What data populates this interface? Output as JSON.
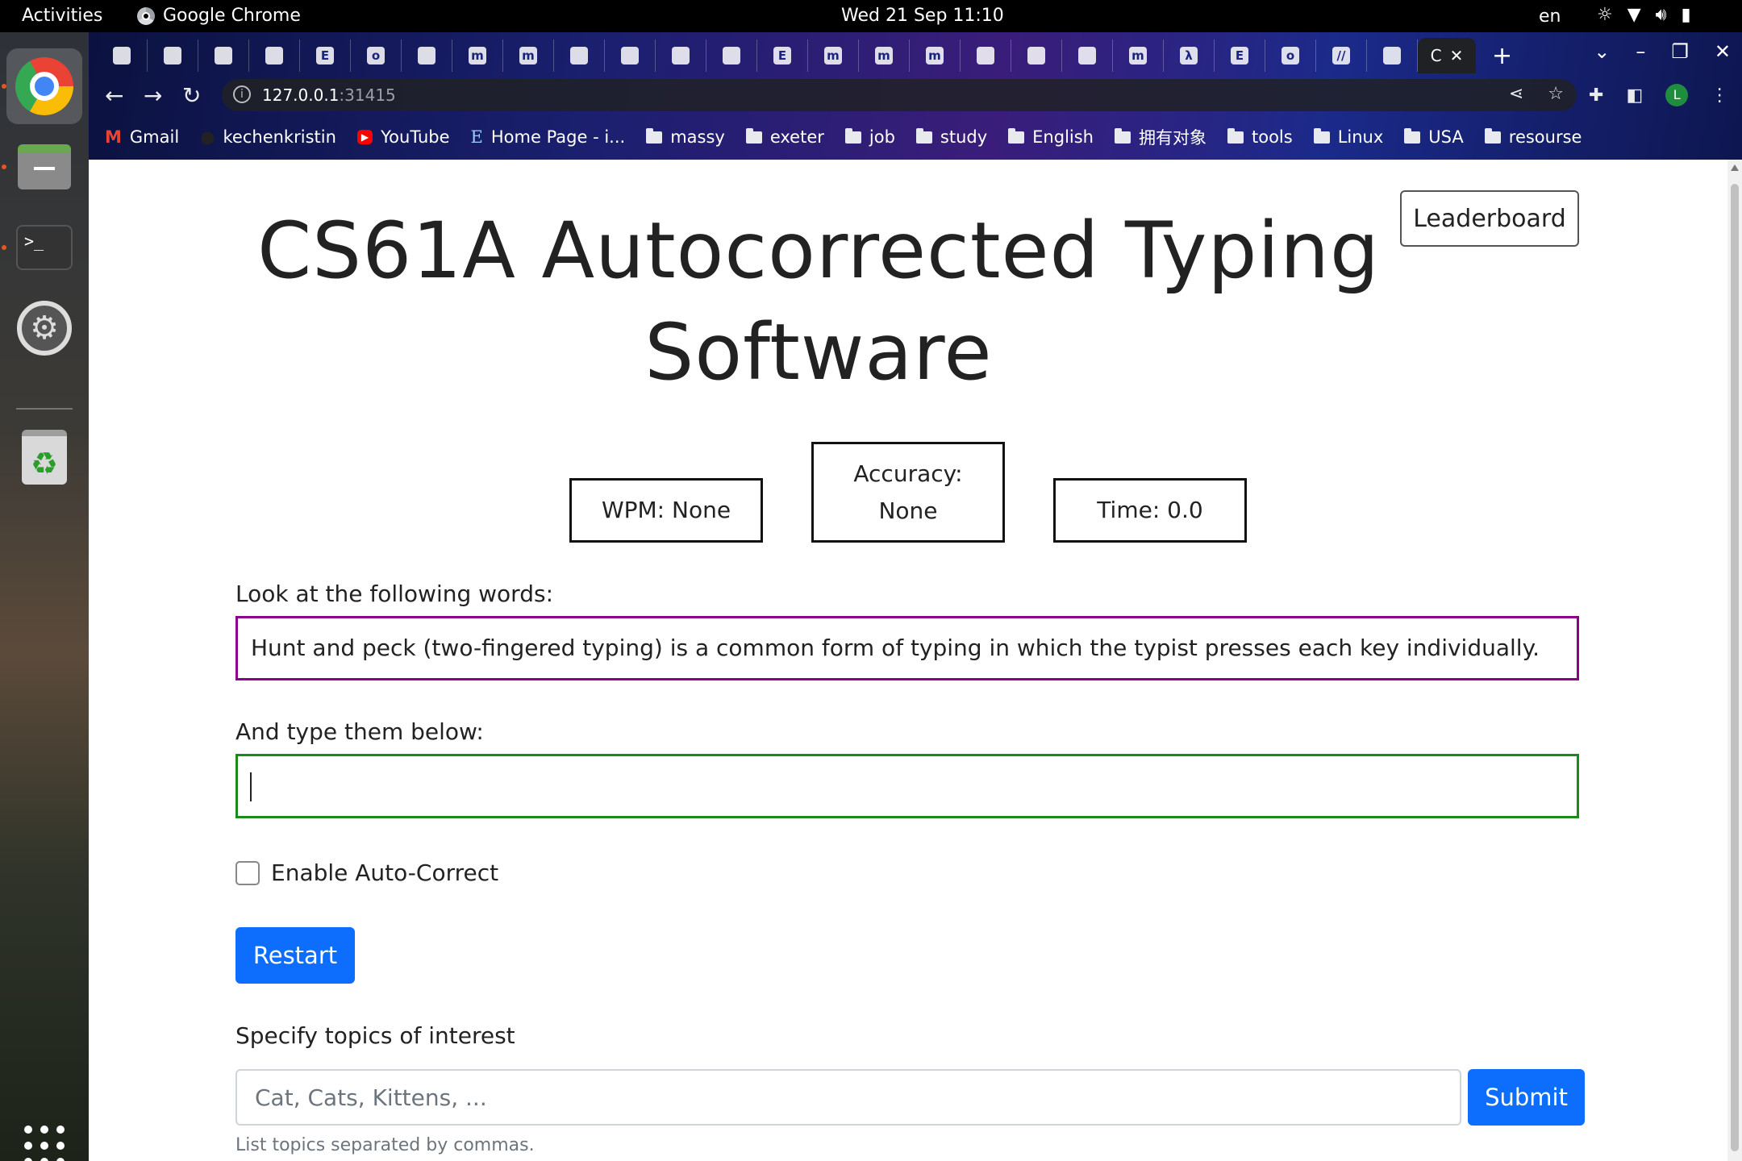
{
  "topbar": {
    "activities": "Activities",
    "app_name": "Google Chrome",
    "clock": "Wed 21 Sep  11:10",
    "language": "en"
  },
  "browser": {
    "url_host": "127.0.0.1",
    "url_port": ":31415",
    "tab_favicons": [
      "",
      "",
      "",
      "",
      "E",
      "o",
      "",
      "m",
      "m",
      "",
      "",
      "",
      "",
      "E",
      "m",
      "m",
      "m",
      "",
      "",
      "",
      "m",
      "λ",
      "E",
      "o",
      "//",
      ""
    ],
    "active_tab_label": "C",
    "profile_initial": "L",
    "bookmarks": [
      {
        "label": "Gmail",
        "icon": "gmail-icon"
      },
      {
        "label": "kechenkristin",
        "icon": "github-icon"
      },
      {
        "label": "YouTube",
        "icon": "youtube-icon"
      },
      {
        "label": "Home Page - i...",
        "icon": "e-icon"
      },
      {
        "label": "massy",
        "icon": "folder-icon"
      },
      {
        "label": "exeter",
        "icon": "folder-icon"
      },
      {
        "label": "job",
        "icon": "folder-icon"
      },
      {
        "label": "study",
        "icon": "folder-icon"
      },
      {
        "label": "English",
        "icon": "folder-icon"
      },
      {
        "label": "拥有对象",
        "icon": "folder-icon"
      },
      {
        "label": "tools",
        "icon": "folder-icon"
      },
      {
        "label": "Linux",
        "icon": "folder-icon"
      },
      {
        "label": "USA",
        "icon": "folder-icon"
      },
      {
        "label": "resourse",
        "icon": "folder-icon"
      }
    ]
  },
  "page": {
    "title": "CS61A Autocorrected Typing Software",
    "leaderboard_label": "Leaderboard",
    "stats": {
      "wpm": "WPM: None",
      "accuracy_label": "Accuracy:",
      "accuracy_value": "None",
      "time": "Time: 0.0"
    },
    "prompt_label": "Look at the following words:",
    "prompt_text": "Hunt and peck (two-fingered typing) is a common form of typing in which the typist presses each key individually.",
    "input_label": "And type them below:",
    "input_value": "",
    "autocorrect_label": "Enable Auto-Correct",
    "autocorrect_checked": false,
    "restart_label": "Restart",
    "topics_label": "Specify topics of interest",
    "topics_placeholder": "Cat, Cats, Kittens, ...",
    "submit_label": "Submit",
    "topics_help": "List topics separated by commas."
  },
  "colors": {
    "primary_button": "#0d6efd",
    "prompt_border": "#8b008b",
    "input_border": "#1a8a1a"
  }
}
